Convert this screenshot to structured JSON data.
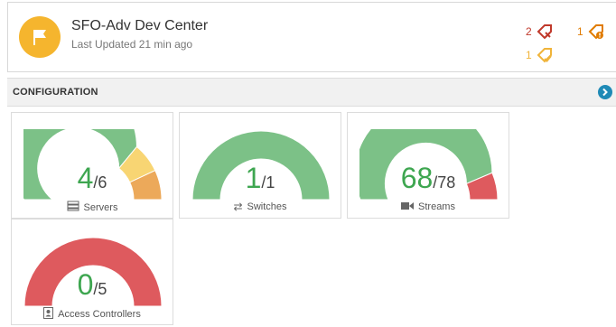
{
  "site": {
    "name": "SFO-Adv Dev Center",
    "updated": "Last Updated 21 min ago"
  },
  "alerts": [
    {
      "count": "2",
      "color": "#c0392b",
      "icon": "tag-x-icon"
    },
    {
      "count": "1",
      "color": "#e07b00",
      "icon": "tag-exclamation-icon"
    },
    {
      "count": "1",
      "color": "#f0b43a",
      "icon": "tag-check-icon"
    }
  ],
  "section": {
    "title": "CONFIGURATION",
    "toggle_icon": "chevron-right-circle-icon"
  },
  "colors": {
    "green": "#7cc187",
    "yellow": "#f8d573",
    "orange": "#eca95a",
    "red": "#de5a5e",
    "value_green": "#3ea650"
  },
  "cards": [
    {
      "label": "Servers",
      "icon": "server-icon",
      "value": "4",
      "total": "/6",
      "segments": [
        {
          "fraction": 0.72,
          "color": "#7cc187"
        },
        {
          "fraction": 0.14,
          "color": "#f8d573"
        },
        {
          "fraction": 0.14,
          "color": "#eca95a"
        }
      ]
    },
    {
      "label": "Switches",
      "icon": "arrows-icon",
      "value": "1",
      "total": "/1",
      "segments": [
        {
          "fraction": 1.0,
          "color": "#7cc187"
        }
      ]
    },
    {
      "label": "Streams",
      "icon": "camera-icon",
      "value": "68",
      "total": "/78",
      "segments": [
        {
          "fraction": 0.872,
          "color": "#7cc187"
        },
        {
          "fraction": 0.128,
          "color": "#de5a5e"
        }
      ]
    },
    {
      "label": "Access Controllers",
      "icon": "badge-icon",
      "value": "0",
      "total": "/5",
      "segments": [
        {
          "fraction": 1.0,
          "color": "#de5a5e"
        }
      ]
    }
  ]
}
